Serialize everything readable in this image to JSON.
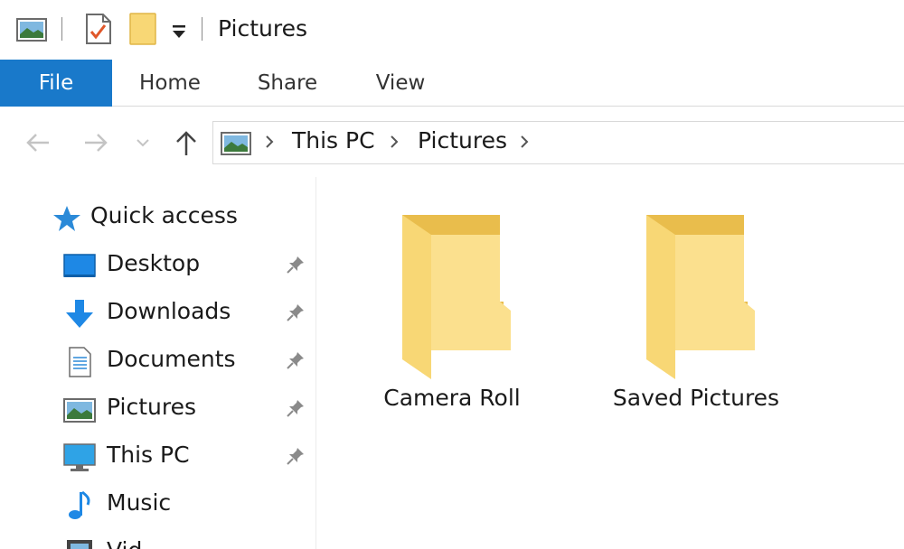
{
  "window": {
    "title": "Pictures"
  },
  "quick_access_toolbar": {
    "icons": [
      "pictures-library-icon",
      "properties-icon",
      "new-folder-icon",
      "customize-dropdown-icon"
    ]
  },
  "ribbon": {
    "tabs": [
      {
        "label": "File",
        "active": true
      },
      {
        "label": "Home"
      },
      {
        "label": "Share"
      },
      {
        "label": "View"
      }
    ]
  },
  "navigation": {
    "buttons": [
      "back-arrow-icon",
      "forward-arrow-icon",
      "recent-locations-icon",
      "up-arrow-icon"
    ],
    "address_bar": {
      "crumbs": [
        "This PC",
        "Pictures"
      ]
    }
  },
  "nav_pane": {
    "quick_access_label": "Quick access",
    "items": [
      {
        "label": "Desktop",
        "icon": "desktop-icon",
        "pinned": true
      },
      {
        "label": "Downloads",
        "icon": "downloads-icon",
        "pinned": true
      },
      {
        "label": "Documents",
        "icon": "documents-icon",
        "pinned": true
      },
      {
        "label": "Pictures",
        "icon": "pictures-icon",
        "pinned": true
      },
      {
        "label": "This PC",
        "icon": "this-pc-icon",
        "pinned": true
      },
      {
        "label": "Music",
        "icon": "music-icon",
        "pinned": false
      },
      {
        "label": "Vid",
        "icon": "videos-icon",
        "pinned": false
      }
    ]
  },
  "content": {
    "folders": [
      {
        "name": "Camera Roll"
      },
      {
        "name": "Saved Pictures"
      }
    ]
  },
  "colors": {
    "file_tab": "#1979ca",
    "folder_front": "#f8d775",
    "folder_back": "#e9bd4c",
    "accent_blue": "#1e88e5"
  }
}
